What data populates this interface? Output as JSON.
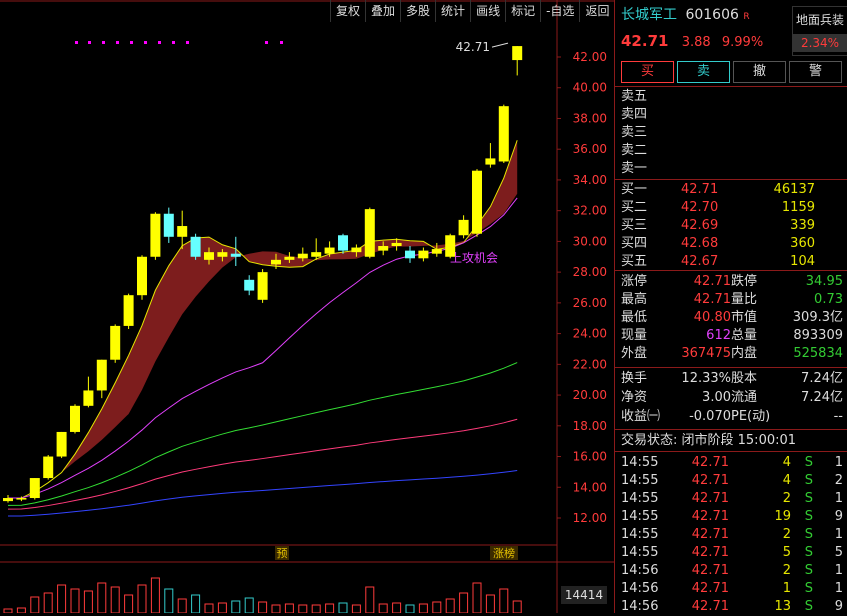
{
  "toolbar": [
    "复权",
    "叠加",
    "多股",
    "统计",
    "画线",
    "标记",
    "-自选",
    "返回"
  ],
  "quote": {
    "name": "长城军工",
    "code": "601606",
    "tag": "R",
    "concept": "地面兵装",
    "concept_pct": "2.34%",
    "price": "42.71",
    "change": "3.88",
    "pct": "9.99%"
  },
  "actions": [
    "买",
    "卖",
    "撤",
    "警"
  ],
  "sell_labels": [
    "卖五",
    "卖四",
    "卖三",
    "卖二",
    "卖一"
  ],
  "buy": [
    {
      "label": "买一",
      "price": "42.71",
      "vol": "46137"
    },
    {
      "label": "买二",
      "price": "42.70",
      "vol": "1159"
    },
    {
      "label": "买三",
      "price": "42.69",
      "vol": "339"
    },
    {
      "label": "买四",
      "price": "42.68",
      "vol": "360"
    },
    {
      "label": "买五",
      "price": "42.67",
      "vol": "104"
    }
  ],
  "stats": [
    {
      "l1": "涨停",
      "v1": "42.71",
      "c1": "red",
      "l2": "跌停",
      "v2": "34.95",
      "c2": "green"
    },
    {
      "l1": "最高",
      "v1": "42.71",
      "c1": "red",
      "l2": "量比",
      "v2": "0.73",
      "c2": "green"
    },
    {
      "l1": "最低",
      "v1": "40.80",
      "c1": "red",
      "l2": "市值",
      "v2": "309.3亿",
      "c2": "white"
    },
    {
      "l1": "现量",
      "v1": "612",
      "c1": "mag",
      "l2": "总量",
      "v2": "893309",
      "c2": "white"
    },
    {
      "l1": "外盘",
      "v1": "367475",
      "c1": "red",
      "l2": "内盘",
      "v2": "525834",
      "c2": "green"
    }
  ],
  "stats2": [
    {
      "l1": "换手",
      "v1": "12.33%",
      "l2": "股本",
      "v2": "7.24亿"
    },
    {
      "l1": "净资",
      "v1": "3.00",
      "l2": "流通",
      "v2": "7.24亿"
    },
    {
      "l1": "收益㈠",
      "v1": "-0.070",
      "l2": "PE(动)",
      "v2": "--"
    }
  ],
  "trade_status": "交易状态: 闭市阶段 15:00:01",
  "ticks": [
    {
      "t": "14:55",
      "p": "42.71",
      "v": "4",
      "s": "S",
      "n": "1"
    },
    {
      "t": "14:55",
      "p": "42.71",
      "v": "4",
      "s": "S",
      "n": "2"
    },
    {
      "t": "14:55",
      "p": "42.71",
      "v": "2",
      "s": "S",
      "n": "1"
    },
    {
      "t": "14:55",
      "p": "42.71",
      "v": "19",
      "s": "S",
      "n": "9"
    },
    {
      "t": "14:55",
      "p": "42.71",
      "v": "2",
      "s": "S",
      "n": "1"
    },
    {
      "t": "14:55",
      "p": "42.71",
      "v": "5",
      "s": "S",
      "n": "5"
    },
    {
      "t": "14:56",
      "p": "42.71",
      "v": "2",
      "s": "S",
      "n": "1"
    },
    {
      "t": "14:56",
      "p": "42.71",
      "v": "1",
      "s": "S",
      "n": "1"
    },
    {
      "t": "14:56",
      "p": "42.71",
      "v": "13",
      "s": "S",
      "n": "9"
    }
  ],
  "chart_data": {
    "type": "candlestick",
    "y_ticks": [
      "42.00",
      "40.00",
      "38.00",
      "36.00",
      "34.00",
      "32.00",
      "30.00",
      "28.00",
      "26.00",
      "24.00",
      "22.00",
      "20.00",
      "18.00",
      "16.00",
      "14.00",
      "12.00"
    ],
    "last_label": "42.71",
    "annotations": [
      "上攻机会",
      "预",
      "涨榜"
    ],
    "volume_label": "14414",
    "colors": {
      "up": "#ffff00",
      "down": "#66ffff",
      "hollow": "#ff3b3b",
      "signal": "#ff00ff"
    },
    "candles": [
      {
        "o": 13.1,
        "c": 13.3,
        "h": 13.5,
        "l": 13.0
      },
      {
        "o": 13.2,
        "c": 13.3,
        "h": 13.4,
        "l": 13.1
      },
      {
        "o": 13.3,
        "c": 14.6,
        "h": 14.6,
        "l": 13.2
      },
      {
        "o": 14.6,
        "c": 16.0,
        "h": 16.1,
        "l": 14.5
      },
      {
        "o": 16.0,
        "c": 17.6,
        "h": 17.6,
        "l": 15.9
      },
      {
        "o": 17.6,
        "c": 19.3,
        "h": 19.4,
        "l": 17.5
      },
      {
        "o": 19.3,
        "c": 20.3,
        "h": 21.2,
        "l": 19.2
      },
      {
        "o": 20.3,
        "c": 22.3,
        "h": 22.3,
        "l": 19.8
      },
      {
        "o": 22.3,
        "c": 24.5,
        "h": 24.6,
        "l": 22.1
      },
      {
        "o": 24.5,
        "c": 26.5,
        "h": 26.6,
        "l": 24.3
      },
      {
        "o": 26.5,
        "c": 29.0,
        "h": 29.1,
        "l": 26.2
      },
      {
        "o": 29.0,
        "c": 31.8,
        "h": 31.9,
        "l": 28.8
      },
      {
        "o": 31.8,
        "c": 30.3,
        "h": 32.2,
        "l": 29.9
      },
      {
        "o": 30.3,
        "c": 31.0,
        "h": 32.0,
        "l": 29.5
      },
      {
        "o": 30.3,
        "c": 29.0,
        "h": 30.5,
        "l": 28.8
      },
      {
        "o": 28.8,
        "c": 29.3,
        "h": 29.6,
        "l": 28.5
      },
      {
        "o": 29.0,
        "c": 29.3,
        "h": 29.5,
        "l": 28.7
      },
      {
        "o": 29.2,
        "c": 29.0,
        "h": 30.3,
        "l": 28.4
      },
      {
        "o": 27.5,
        "c": 26.8,
        "h": 27.8,
        "l": 26.5
      },
      {
        "o": 26.2,
        "c": 28.0,
        "h": 28.2,
        "l": 26.0
      },
      {
        "o": 28.5,
        "c": 28.8,
        "h": 29.2,
        "l": 28.2
      },
      {
        "o": 28.8,
        "c": 29.0,
        "h": 29.3,
        "l": 28.6
      },
      {
        "o": 28.9,
        "c": 29.2,
        "h": 29.6,
        "l": 28.7
      },
      {
        "o": 29.0,
        "c": 29.3,
        "h": 30.2,
        "l": 28.8
      },
      {
        "o": 29.2,
        "c": 29.6,
        "h": 30.0,
        "l": 29.0
      },
      {
        "o": 30.4,
        "c": 29.4,
        "h": 30.5,
        "l": 29.2
      },
      {
        "o": 29.3,
        "c": 29.6,
        "h": 29.8,
        "l": 29.0
      },
      {
        "o": 29.0,
        "c": 32.1,
        "h": 32.2,
        "l": 28.9
      },
      {
        "o": 29.4,
        "c": 29.7,
        "h": 30.0,
        "l": 29.1
      },
      {
        "o": 29.7,
        "c": 29.9,
        "h": 30.2,
        "l": 29.4
      },
      {
        "o": 29.4,
        "c": 28.9,
        "h": 29.7,
        "l": 28.6
      },
      {
        "o": 28.9,
        "c": 29.4,
        "h": 29.6,
        "l": 28.7
      },
      {
        "o": 29.2,
        "c": 29.5,
        "h": 29.9,
        "l": 29.0
      },
      {
        "o": 29.0,
        "c": 30.4,
        "h": 30.5,
        "l": 28.9
      },
      {
        "o": 30.4,
        "c": 31.4,
        "h": 31.7,
        "l": 30.2
      },
      {
        "o": 30.5,
        "c": 34.6,
        "h": 34.7,
        "l": 30.3
      },
      {
        "o": 35.0,
        "c": 35.4,
        "h": 36.4,
        "l": 34.8
      },
      {
        "o": 35.2,
        "c": 38.8,
        "h": 38.9,
        "l": 35.1
      },
      {
        "o": 41.8,
        "c": 42.71,
        "h": 42.71,
        "l": 40.8
      }
    ]
  }
}
